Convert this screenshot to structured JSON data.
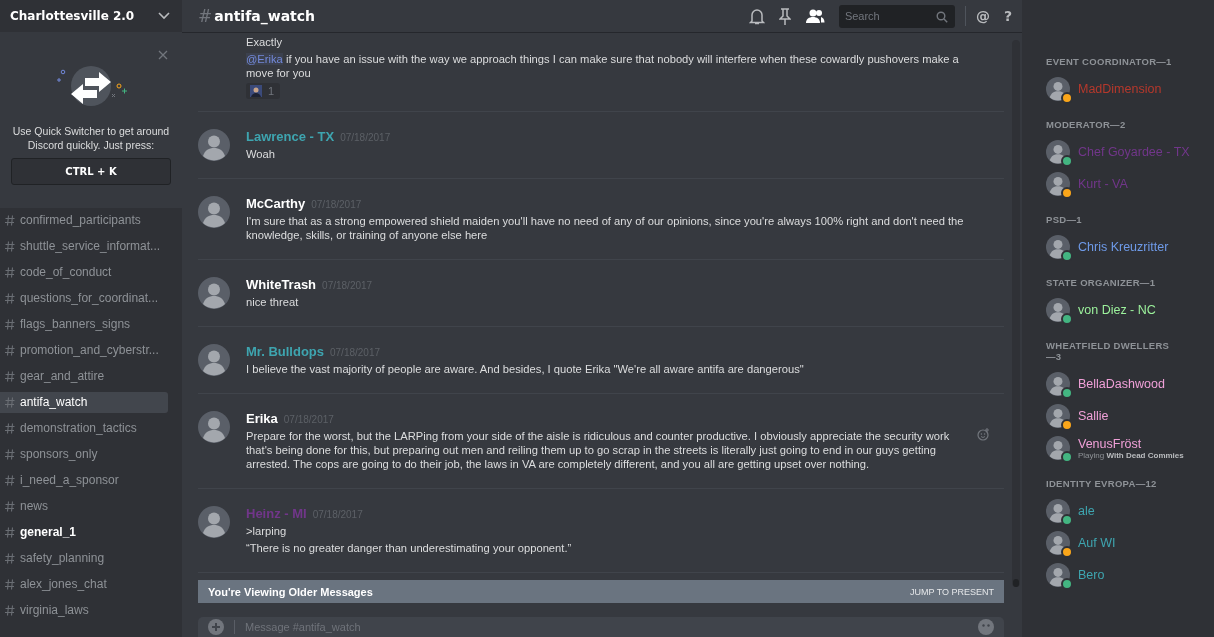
{
  "server": {
    "name": "Charlottesville 2.0"
  },
  "quick_switcher": {
    "text": "Use Quick Switcher to get around Discord quickly. Just press:",
    "shortcut": "CTRL + K"
  },
  "channels": [
    {
      "name": "confirmed_participants",
      "selected": false,
      "unread": false
    },
    {
      "name": "shuttle_service_informat...",
      "selected": false,
      "unread": false
    },
    {
      "name": "code_of_conduct",
      "selected": false,
      "unread": false
    },
    {
      "name": "questions_for_coordinat...",
      "selected": false,
      "unread": false
    },
    {
      "name": "flags_banners_signs",
      "selected": false,
      "unread": false
    },
    {
      "name": "promotion_and_cyberstr...",
      "selected": false,
      "unread": false
    },
    {
      "name": "gear_and_attire",
      "selected": false,
      "unread": false
    },
    {
      "name": "antifa_watch",
      "selected": true,
      "unread": false
    },
    {
      "name": "demonstration_tactics",
      "selected": false,
      "unread": false
    },
    {
      "name": "sponsors_only",
      "selected": false,
      "unread": false
    },
    {
      "name": "i_need_a_sponsor",
      "selected": false,
      "unread": false
    },
    {
      "name": "news",
      "selected": false,
      "unread": false
    },
    {
      "name": "general_1",
      "selected": false,
      "unread": true
    },
    {
      "name": "safety_planning",
      "selected": false,
      "unread": false
    },
    {
      "name": "alex_jones_chat",
      "selected": false,
      "unread": false
    },
    {
      "name": "virginia_laws",
      "selected": false,
      "unread": false
    }
  ],
  "channel_header": {
    "hash": "#",
    "name": "antifa_watch"
  },
  "toolbar": {
    "member_list_open": true,
    "search": {
      "placeholder": "Search"
    },
    "mention_glyph": "@",
    "help_glyph": "?"
  },
  "messages": [
    {
      "kind": "continued",
      "lines": [
        {
          "text": "Exactly"
        },
        {
          "mention": "@Erika",
          "text": "if you have an issue with the way we approach things I can make sure that nobody will interfere when these cowardly pushovers make a move for you"
        }
      ],
      "reactions": [
        {
          "count": "1"
        }
      ]
    },
    {
      "kind": "group",
      "author": "Lawrence - TX",
      "color": "#3ea5b0",
      "timestamp": "07/18/2017",
      "lines": [
        {
          "text": "Woah"
        }
      ]
    },
    {
      "kind": "group",
      "author": "McCarthy",
      "color": "#ffffff",
      "timestamp": "07/18/2017",
      "lines": [
        {
          "text": "I'm sure that as a strong empowered shield maiden you'll have no need of any of our opinions, since you're always 100% right and don't need the knowledge, skills, or training of anyone else here"
        }
      ]
    },
    {
      "kind": "group",
      "author": "WhiteTrash",
      "color": "#ffffff",
      "timestamp": "07/18/2017",
      "lines": [
        {
          "text": "nice threat"
        }
      ]
    },
    {
      "kind": "group",
      "author": "Mr. Bulldops",
      "color": "#3ea5b0",
      "timestamp": "07/18/2017",
      "lines": [
        {
          "text": "I believe the vast majority of people are aware. And besides, I quote Erika \"We're all aware antifa are dangerous\""
        }
      ]
    },
    {
      "kind": "group",
      "author": "Erika",
      "color": "#ffffff",
      "timestamp": "07/18/2017",
      "add_reaction_shown": true,
      "lines": [
        {
          "text": "Prepare for the worst, but the LARPing from your side of the aisle is ridiculous and counter productive. I obviously appreciate the security work that's being done for this, but preparing out men and reiling them up to go scrap in the streets is literally just going to end in our guys getting arrested. The cops are going to do their job, the laws in VA are completely different, and you all are getting upset over nothing."
        }
      ]
    },
    {
      "kind": "group",
      "author": "Heinz - MI",
      "color": "#71368a",
      "timestamp": "07/18/2017",
      "lines": [
        {
          "text": ">larping"
        },
        {
          "text": "“There is no greater danger than underestimating your opponent.”"
        }
      ]
    }
  ],
  "older_messages_bar": {
    "text": "You're Viewing Older Messages",
    "action": "JUMP TO PRESENT"
  },
  "composer": {
    "placeholder": "Message #antifa_watch"
  },
  "member_groups": [
    {
      "title": "EVENT COORDINATOR—1",
      "members": [
        {
          "name": "MadDimension",
          "color": "#b5382c",
          "idle": true
        }
      ]
    },
    {
      "title": "MODERATOR—2",
      "members": [
        {
          "name": "Chef Goyardee - TX",
          "color": "#71368a",
          "idle": false
        },
        {
          "name": "Kurt - VA",
          "color": "#71368a",
          "idle": true
        }
      ]
    },
    {
      "title": "PSD—1",
      "members": [
        {
          "name": "Chris Kreuzritter",
          "color": "#6e9ae8",
          "idle": false
        }
      ]
    },
    {
      "title": "STATE ORGANIZER—1",
      "members": [
        {
          "name": "von Diez - NC",
          "color": "#9cf29c",
          "idle": false
        }
      ]
    },
    {
      "title": "WHEATFIELD DWELLERS—3",
      "members": [
        {
          "name": "BellaDashwood",
          "color": "#f0a0d8",
          "idle": false
        },
        {
          "name": "Sallie",
          "color": "#f0a0d8",
          "idle": true
        },
        {
          "name": "VenusFröst",
          "color": "#f0a0d8",
          "idle": false,
          "activity": {
            "verb": "Playing",
            "name": "With Dead Commies"
          }
        }
      ]
    },
    {
      "title": "IDENTITY EVROPA—12",
      "members": [
        {
          "name": "ale",
          "color": "#3ea5b0",
          "idle": false
        },
        {
          "name": "Auf WI",
          "color": "#3ea5b0",
          "idle": true
        },
        {
          "name": "Bero",
          "color": "#3ea5b0",
          "idle": false
        }
      ]
    }
  ]
}
